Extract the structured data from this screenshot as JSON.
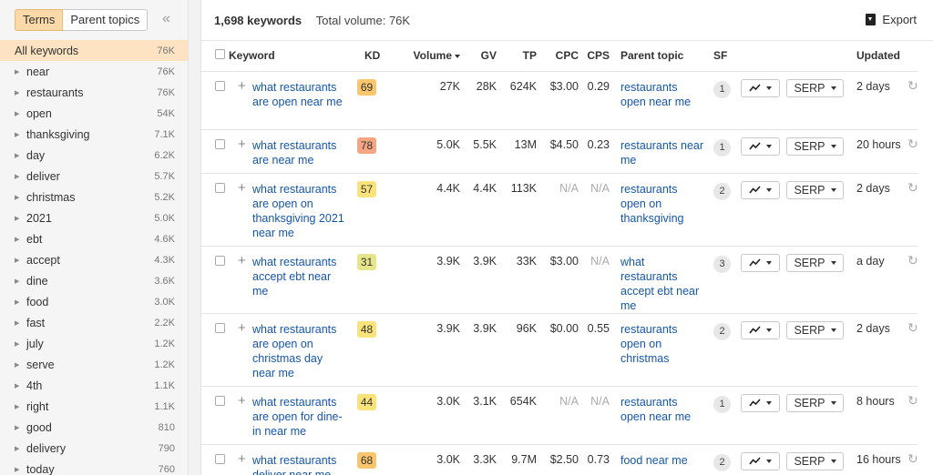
{
  "sidebar": {
    "tabs": [
      {
        "label": "Terms",
        "active": true
      },
      {
        "label": "Parent topics",
        "active": false
      }
    ],
    "collapse_icon": "double-chevron-left-icon",
    "items": [
      {
        "label": "All keywords",
        "count": "76K",
        "active": true
      },
      {
        "label": "near",
        "count": "76K"
      },
      {
        "label": "restaurants",
        "count": "76K"
      },
      {
        "label": "open",
        "count": "54K"
      },
      {
        "label": "thanksgiving",
        "count": "7.1K"
      },
      {
        "label": "day",
        "count": "6.2K"
      },
      {
        "label": "deliver",
        "count": "5.7K"
      },
      {
        "label": "christmas",
        "count": "5.2K"
      },
      {
        "label": "2021",
        "count": "5.0K"
      },
      {
        "label": "ebt",
        "count": "4.6K"
      },
      {
        "label": "accept",
        "count": "4.3K"
      },
      {
        "label": "dine",
        "count": "3.6K"
      },
      {
        "label": "food",
        "count": "3.0K"
      },
      {
        "label": "fast",
        "count": "2.2K"
      },
      {
        "label": "july",
        "count": "1.2K"
      },
      {
        "label": "serve",
        "count": "1.2K"
      },
      {
        "label": "4th",
        "count": "1.1K"
      },
      {
        "label": "right",
        "count": "1.1K"
      },
      {
        "label": "good",
        "count": "810"
      },
      {
        "label": "delivery",
        "count": "790"
      },
      {
        "label": "today",
        "count": "760"
      }
    ]
  },
  "summary": {
    "keywords_count": "1,698 keywords",
    "total_volume": "Total volume: 76K"
  },
  "export_label": "Export",
  "columns": {
    "keyword": "Keyword",
    "kd": "KD",
    "volume": "Volume",
    "gv": "GV",
    "tp": "TP",
    "cpc": "CPC",
    "cps": "CPS",
    "parent_topic": "Parent topic",
    "sf": "SF",
    "updated": "Updated"
  },
  "serp_label": "SERP",
  "kd_colors": {
    "green_yellow": "#e7e58a",
    "yellow": "#fbe37b",
    "orange": "#f9c56d",
    "salmon": "#f6a582"
  },
  "rows": [
    {
      "keyword": "what restaurants are open near me",
      "kd": "69",
      "kd_color": "#f9c56d",
      "volume": "27K",
      "gv": "28K",
      "tp": "624K",
      "cpc": "$3.00",
      "cps": "0.29",
      "parent_topic": "restaurants open near me",
      "sf": "1",
      "updated": "2 days"
    },
    {
      "keyword": "what restaurants are near me",
      "kd": "78",
      "kd_color": "#f6a582",
      "volume": "5.0K",
      "gv": "5.5K",
      "tp": "13M",
      "cpc": "$4.50",
      "cps": "0.23",
      "parent_topic": "restaurants near me",
      "sf": "1",
      "updated": "20 hours"
    },
    {
      "keyword": "what restaurants are open on thanksgiving 2021 near me",
      "kd": "57",
      "kd_color": "#fbe37b",
      "volume": "4.4K",
      "gv": "4.4K",
      "tp": "113K",
      "cpc": "N/A",
      "cps": "N/A",
      "parent_topic": "restaurants open on thanksgiving",
      "sf": "2",
      "updated": "2 days"
    },
    {
      "keyword": "what restaurants accept ebt near me",
      "kd": "31",
      "kd_color": "#e7e58a",
      "volume": "3.9K",
      "gv": "3.9K",
      "tp": "33K",
      "cpc": "$3.00",
      "cps": "N/A",
      "parent_topic": "what restaurants accept ebt near me",
      "sf": "3",
      "updated": "a day"
    },
    {
      "keyword": "what restaurants are open on christmas day near me",
      "kd": "48",
      "kd_color": "#fbe37b",
      "volume": "3.9K",
      "gv": "3.9K",
      "tp": "96K",
      "cpc": "$0.00",
      "cps": "0.55",
      "parent_topic": "restaurants open on christmas",
      "sf": "2",
      "updated": "2 days"
    },
    {
      "keyword": "what restaurants are open for dine-in near me",
      "kd": "44",
      "kd_color": "#fbe37b",
      "volume": "3.0K",
      "gv": "3.1K",
      "tp": "654K",
      "cpc": "N/A",
      "cps": "N/A",
      "parent_topic": "restaurants open near me",
      "sf": "1",
      "updated": "8 hours"
    },
    {
      "keyword": "what restaurants deliver near me",
      "kd": "68",
      "kd_color": "#f9c56d",
      "volume": "3.0K",
      "gv": "3.3K",
      "tp": "9.7M",
      "cpc": "$2.50",
      "cps": "0.73",
      "parent_topic": "food near me",
      "sf": "2",
      "updated": "16 hours"
    }
  ]
}
